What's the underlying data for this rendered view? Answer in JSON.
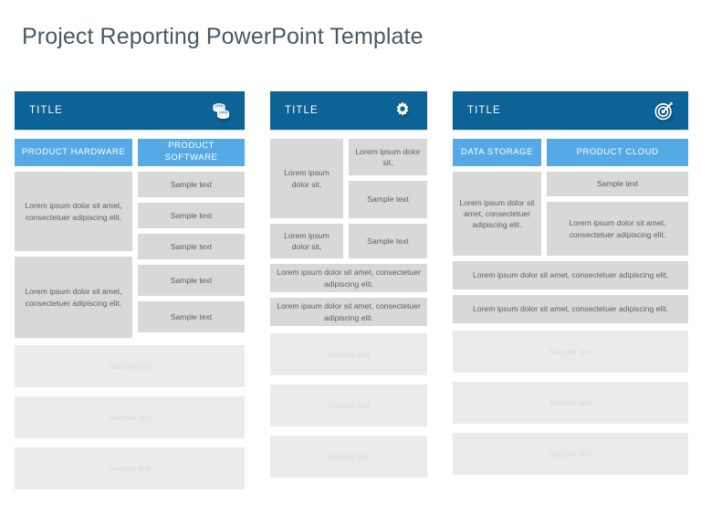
{
  "page": {
    "title": "Project Reporting PowerPoint Template"
  },
  "colors": {
    "header_blue": "#0d6296",
    "subheader_blue": "#55aae5",
    "cell_gray": "#d8d8d8",
    "faded_gray": "#ebebeb",
    "title_text": "#4a5862"
  },
  "columns": [
    {
      "title": "TITLE",
      "icon": "coins-stack-icon",
      "sub_a": {
        "header": "PRODUCT HARDWARE",
        "cells": [
          "Lorem ipsum dolor sit amet, consectetuer adipiscing elit.",
          "Lorem ipsum dolor sit amet, consectetuer adipiscing elit."
        ]
      },
      "sub_b": {
        "header": "PRODUCT SOFTWARE",
        "cells": [
          "Sample text",
          "Sample text",
          "Sample text",
          "Sample text",
          "Sample text"
        ]
      },
      "faded": [
        "Sample text",
        "Sample text",
        "Sample text"
      ]
    },
    {
      "title": "TITLE",
      "icon": "gear-icon",
      "sub_a": {
        "header": "",
        "cells": [
          "Lorem ipsum dolor sit,",
          "Lorem ipsum dolor sit,"
        ]
      },
      "sub_b": {
        "header": "",
        "cells": [
          "Lorem ipsum dolor sit,",
          "Sample text",
          "Sample text"
        ]
      },
      "wide_cells": [
        "Lorem ipsum dolor sit amet, consectetuer adipiscing elit.",
        "Lorem ipsum dolor sit amet, consectetuer adipiscing elit."
      ],
      "faded": [
        "Sample text",
        "Sample text",
        "Sample text"
      ]
    },
    {
      "title": "TITLE",
      "icon": "target-arrow-icon",
      "sub_a": {
        "header": "DATA STORAGE",
        "cells": [
          "Lorem ipsum dolor sit amet, consectetuer adipiscing elit."
        ]
      },
      "sub_b": {
        "header": "PRODUCT CLOUD",
        "cells": [
          "Sample text",
          "Lorem ipsum dolor sit amet, consectetuer adipiscing elit."
        ]
      },
      "wide_cells": [
        "Lorem ipsum dolor sit amet, consectetuer adipiscing elit.",
        "Lorem ipsum dolor sit amet, consectetuer adipiscing elit."
      ],
      "faded": [
        "Sample text",
        "Sample text",
        "Sample text"
      ]
    }
  ]
}
